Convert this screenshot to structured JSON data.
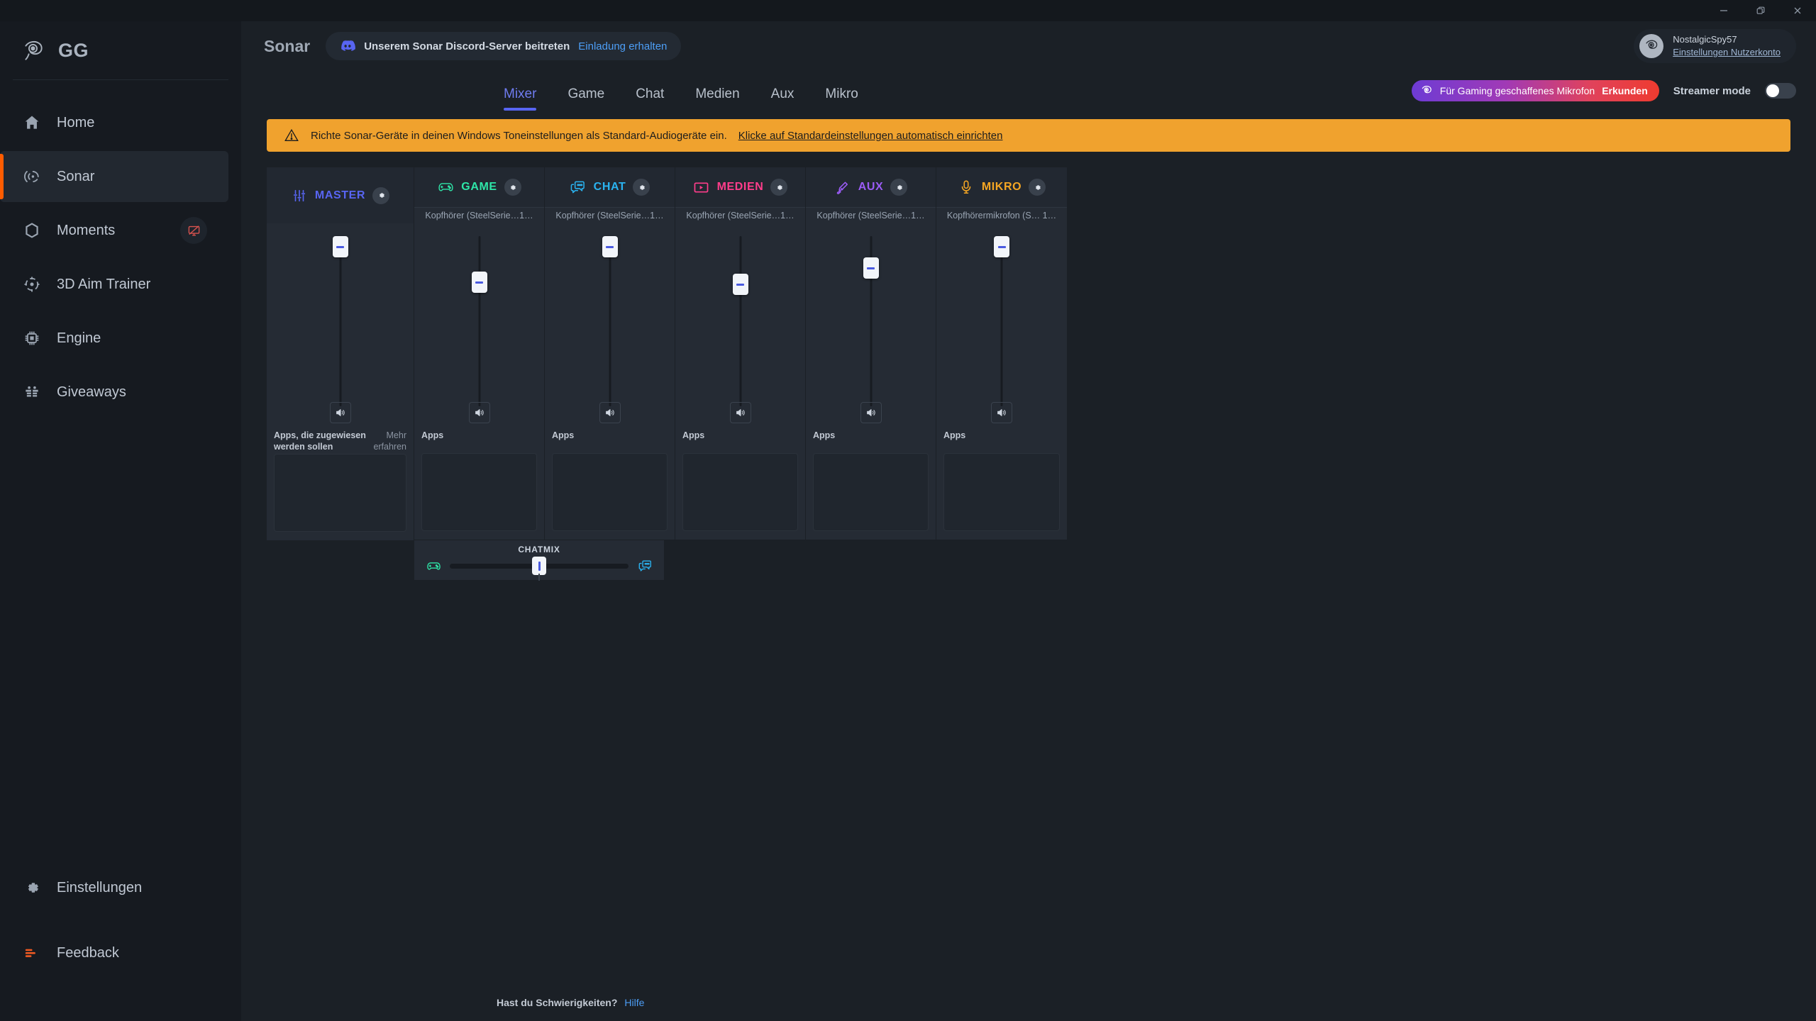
{
  "window": {
    "minimize_label": "Minimieren",
    "restore_label": "Wiederherstellen",
    "close_label": "Schließen"
  },
  "sidebar": {
    "brand": "GG",
    "brand_icon": "steelseries-logo-icon",
    "items": [
      {
        "label": "Home",
        "icon": "home-icon",
        "active": false
      },
      {
        "label": "Sonar",
        "icon": "sonar-icon",
        "active": true
      },
      {
        "label": "Moments",
        "icon": "hexagon-icon",
        "active": false,
        "badge_icon": "screen-recording-disabled-icon"
      },
      {
        "label": "3D Aim Trainer",
        "icon": "crosshair-icon",
        "active": false
      },
      {
        "label": "Engine",
        "icon": "chip-icon",
        "active": false
      },
      {
        "label": "Giveaways",
        "icon": "gift-icon",
        "active": false
      }
    ],
    "bottom_items": [
      {
        "label": "Einstellungen",
        "icon": "gear-icon"
      },
      {
        "label": "Feedback",
        "icon": "feedback-bars-icon"
      }
    ],
    "accent": "#ff5c00"
  },
  "topbar": {
    "title": "Sonar",
    "discord": {
      "icon": "discord-icon",
      "text": "Unserem Sonar Discord-Server beitreten",
      "link": "Einladung erhalten",
      "link_color": "#4d9ef6"
    },
    "user": {
      "name": "NostalgicSpy57",
      "link": "Einstellungen Nutzerkonto",
      "avatar_icon": "steelseries-avatar-icon"
    }
  },
  "tabs": [
    {
      "label": "Mixer",
      "active": true
    },
    {
      "label": "Game",
      "active": false
    },
    {
      "label": "Chat",
      "active": false
    },
    {
      "label": "Medien",
      "active": false
    },
    {
      "label": "Aux",
      "active": false
    },
    {
      "label": "Mikro",
      "active": false
    }
  ],
  "tabs_accent": "#5865f2",
  "promo": {
    "icon": "steelseries-logo-icon",
    "text": "Für Gaming geschaffenes Mikrofon",
    "cta": "Erkunden"
  },
  "streamer_mode": {
    "label": "Streamer mode",
    "enabled": false
  },
  "alert": {
    "icon": "warning-triangle-icon",
    "text": "Richte Sonar-Geräte in deinen Windows Toneinstellungen als Standard-Audiogeräte ein.",
    "link": "Klicke auf Standardeinstellungen automatisch einrichten",
    "background": "#f0a22e"
  },
  "mixer": {
    "master": {
      "name": "MASTER",
      "icon": "sliders-icon",
      "color": "#5865f2",
      "gear_icon": "gear-icon",
      "device": "",
      "fader_percent": 94,
      "speaker_icon": "speaker-icon",
      "apps_label": "Apps, die zugewiesen werden sollen",
      "apps_more": "Mehr erfahren"
    },
    "channels": [
      {
        "name": "GAME",
        "icon": "gamepad-icon",
        "color": "#2ee6a8",
        "gear_icon": "gear-icon",
        "device": "Kopfhörer (SteelSerie…1…",
        "fader_percent": 74,
        "speaker_icon": "speaker-icon",
        "apps_label": "Apps"
      },
      {
        "name": "CHAT",
        "icon": "chat-bubble-icon",
        "color": "#2ab3f0",
        "gear_icon": "gear-icon",
        "device": "Kopfhörer (SteelSerie…1…",
        "fader_percent": 94,
        "speaker_icon": "speaker-icon",
        "apps_label": "Apps"
      },
      {
        "name": "MEDIEN",
        "icon": "media-play-icon",
        "color": "#ff3d8b",
        "gear_icon": "gear-icon",
        "device": "Kopfhörer (SteelSerie…1…",
        "fader_percent": 73,
        "speaker_icon": "speaker-icon",
        "apps_label": "Apps"
      },
      {
        "name": "AUX",
        "icon": "aux-cable-icon",
        "color": "#9b5cf6",
        "gear_icon": "gear-icon",
        "device": "Kopfhörer (SteelSerie…1…",
        "fader_percent": 82,
        "speaker_icon": "speaker-icon",
        "apps_label": "Apps"
      },
      {
        "name": "MIKRO",
        "icon": "microphone-icon",
        "color": "#f5a623",
        "gear_icon": "gear-icon",
        "device": "Kopfhörermikrofon (S… 1…",
        "fader_percent": 94,
        "speaker_icon": "speaker-icon",
        "apps_label": "Apps"
      }
    ],
    "chatmix": {
      "title": "CHATMIX",
      "left_icon": "gamepad-icon",
      "right_icon": "chat-bubble-icon",
      "value_percent": 50
    }
  },
  "footer": {
    "question": "Hast du Schwierigkeiten?",
    "link": "Hilfe"
  }
}
